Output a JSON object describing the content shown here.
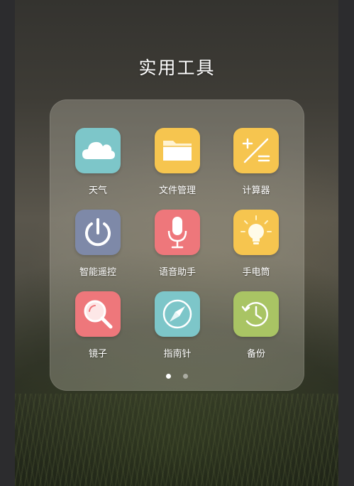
{
  "folder": {
    "title": "实用工具",
    "page_count": 2,
    "active_page": 1
  },
  "apps": [
    {
      "label": "天气",
      "icon": "cloud-icon",
      "color": "#7dc6c9"
    },
    {
      "label": "文件管理",
      "icon": "folder-icon",
      "color": "#f6c54f"
    },
    {
      "label": "计算器",
      "icon": "calculator-icon",
      "color": "#f6c54f"
    },
    {
      "label": "智能遥控",
      "icon": "power-icon",
      "color": "#7e89a8"
    },
    {
      "label": "语音助手",
      "icon": "microphone-icon",
      "color": "#ee777b"
    },
    {
      "label": "手电筒",
      "icon": "lightbulb-icon",
      "color": "#f6c54f"
    },
    {
      "label": "镜子",
      "icon": "magnifier-icon",
      "color": "#ee777b"
    },
    {
      "label": "指南针",
      "icon": "compass-icon",
      "color": "#7dc6c9"
    },
    {
      "label": "备份",
      "icon": "backup-clock-icon",
      "color": "#a9c464"
    }
  ]
}
